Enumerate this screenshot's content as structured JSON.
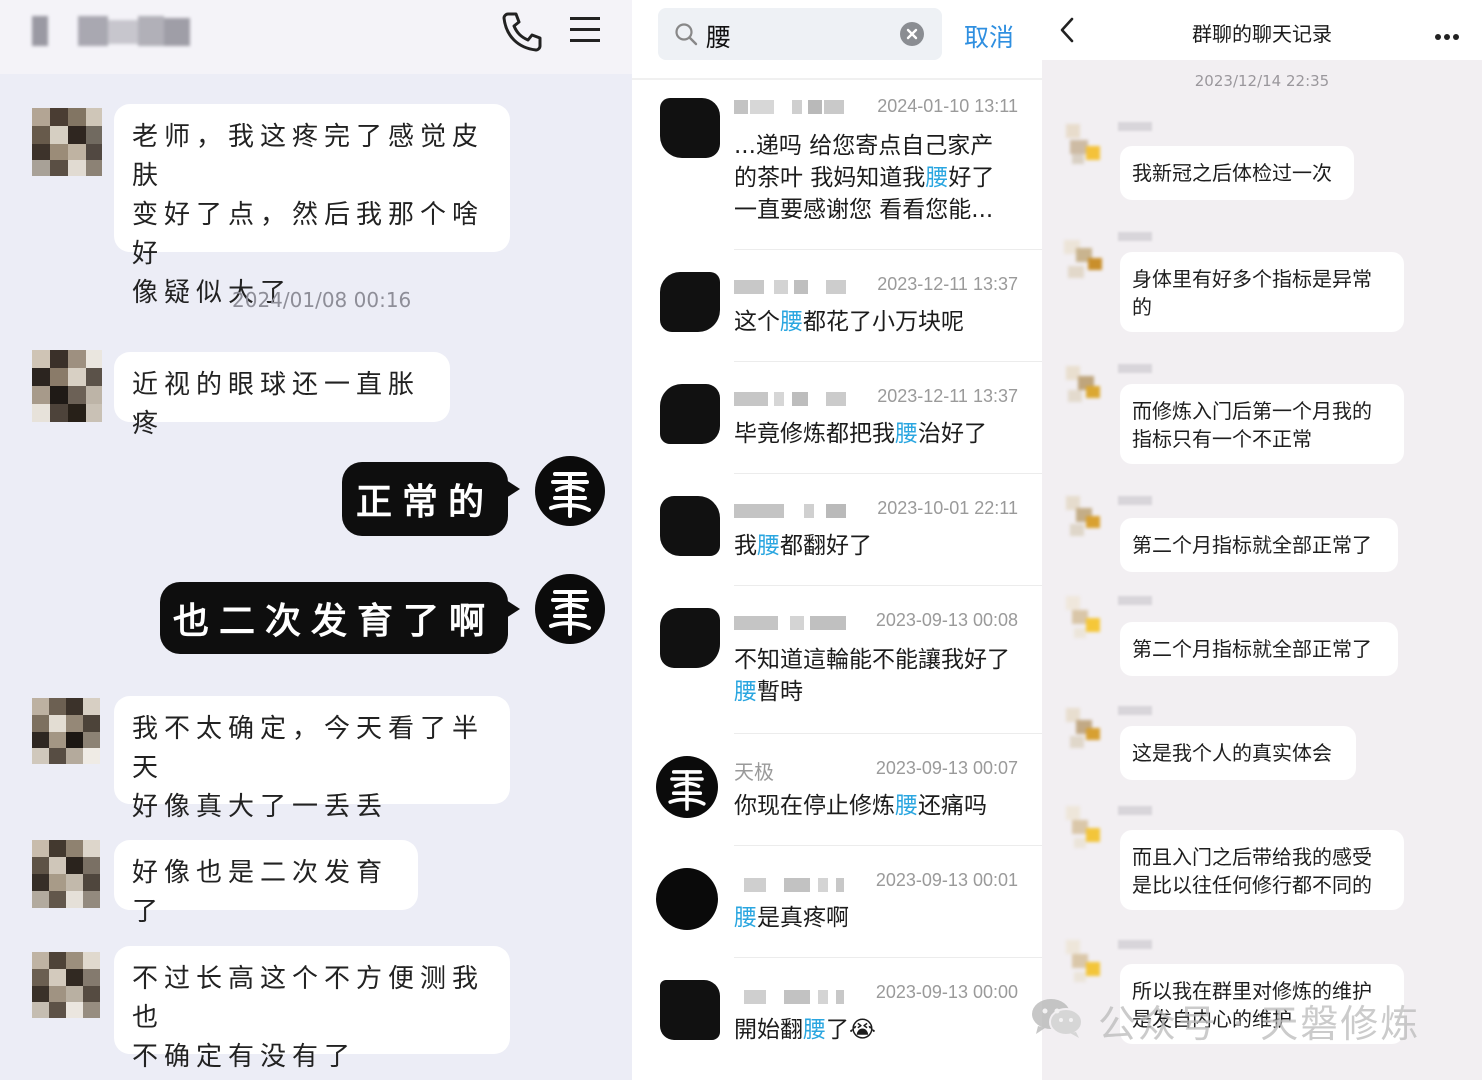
{
  "left_chat": {
    "timestamp": "2024/01/08 00:16",
    "messages": [
      {
        "side": "left",
        "text": "老师，我这疼完了感觉皮肤\n变好了点，然后我那个啥好\n像疑似大了"
      },
      {
        "side": "left",
        "text": "近视的眼球还一直胀疼"
      },
      {
        "side": "right",
        "text": "正常的"
      },
      {
        "side": "right",
        "text": "也二次发育了啊"
      },
      {
        "side": "left",
        "text": "我不太确定，今天看了半天\n好像真大了一丢丢"
      },
      {
        "side": "left",
        "text": "好像也是二次发育了"
      },
      {
        "side": "left",
        "text": "不过长高这个不方便测我也\n不确定有没有了"
      }
    ],
    "icons": [
      "phone-icon",
      "menu-icon"
    ]
  },
  "search": {
    "query": "腰",
    "cancel_label": "取消",
    "results": [
      {
        "name": "",
        "time": "2024-01-10 13:11",
        "pre": "...递吗 给您寄点自己家产的茶叶 我妈知道我",
        "hit": "腰",
        "post": "好了一直要感谢您 看看您能..."
      },
      {
        "name": "",
        "time": "2023-12-11 13:37",
        "pre": "这个",
        "hit": "腰",
        "post": "都花了小万块呢"
      },
      {
        "name": "",
        "time": "2023-12-11 13:37",
        "pre": "毕竟修炼都把我",
        "hit": "腰",
        "post": "治好了"
      },
      {
        "name": "",
        "time": "2023-10-01 22:11",
        "pre": "我",
        "hit": "腰",
        "post": "都翻好了"
      },
      {
        "name": "",
        "time": "2023-09-13 00:08",
        "pre": "不知道這輪能不能讓我好了",
        "hit": "腰",
        "post": "暫時"
      },
      {
        "name": "天极",
        "time": "2023-09-13 00:07",
        "pre": "你现在停止修炼",
        "hit": "腰",
        "post": "还痛吗"
      },
      {
        "name": "",
        "time": "2023-09-13 00:01",
        "pre": "",
        "hit": "腰",
        "post": "是真疼啊"
      },
      {
        "name": "",
        "time": "2023-09-13 00:00",
        "pre": "開始翻",
        "hit": "腰",
        "post": "了😭"
      }
    ]
  },
  "history": {
    "title": "群聊的聊天记录",
    "timestamp": "2023/12/14 22:35",
    "messages": [
      "我新冠之后体检过一次",
      "身体里有好多个指标是异常\n的",
      "而修炼入门后第一个月我的\n指标只有一个不正常",
      "第二个月指标就全部正常了",
      "第二个月指标就全部正常了",
      "这是我个人的真实体会",
      "而且入门之后带给我的感受\n是比以往任何修行都不同的",
      "所以我在群里对修炼的维护\n是发自内心的维护"
    ]
  },
  "watermark": {
    "text": "公众号 · 天磐修炼"
  },
  "colors": {
    "highlight": "#2aa6e0",
    "dark_bubble": "#0e0e0e",
    "left_bg": "#ecedf6",
    "right_bg": "#f2eff2"
  }
}
